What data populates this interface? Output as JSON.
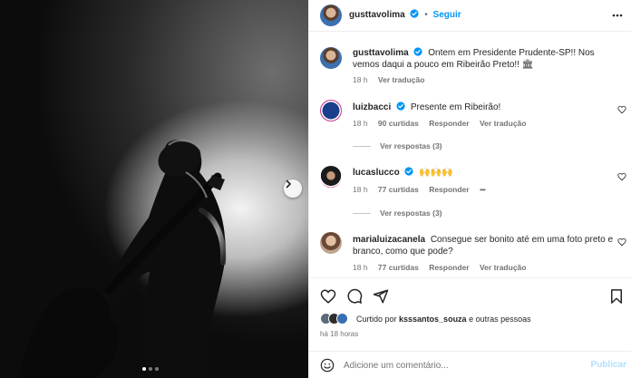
{
  "post": {
    "author": "gusttavolima",
    "follow_label": "Seguir",
    "separator": "•"
  },
  "caption": {
    "username": "gusttavolima",
    "text": "Ontem em Presidente Prudente-SP!! Nos vemos daqui a pouco em Ribeirão Preto!! 🏛",
    "time": "18 h",
    "translate": "Ver tradução"
  },
  "comments": [
    {
      "username": "luizbacci",
      "verified": true,
      "text": "Presente em Ribeirão!",
      "time": "18 h",
      "likes": "90 curtidas",
      "reply": "Responder",
      "translate": "Ver tradução",
      "view_replies": "Ver respostas (3)"
    },
    {
      "username": "lucaslucco",
      "verified": true,
      "text": "🙌🙌🙌",
      "time": "18 h",
      "likes": "77 curtidas",
      "reply": "Responder",
      "more": "•••",
      "view_replies": "Ver respostas (3)"
    },
    {
      "username": "marialuizacanela",
      "verified": false,
      "text": "Consegue ser bonito até em uma foto preto e branco, como que pode?",
      "time": "18 h",
      "likes": "77 curtidas",
      "reply": "Responder",
      "translate": "Ver tradução"
    }
  ],
  "likes": {
    "prefix": "Curtido por ",
    "user": "ksssantos_souza",
    "suffix": " e outras pessoas"
  },
  "post_time": "há 18 horas",
  "add_comment": {
    "placeholder": "Adicione um comentário...",
    "publish": "Publicar"
  },
  "carousel": {
    "slides": 3,
    "active_index": 1
  },
  "colors": {
    "accent": "#0095f6",
    "text": "#262626",
    "muted": "#737373",
    "border": "#efefef"
  },
  "icons": {
    "verified": "verified-badge-icon",
    "heart": "heart-icon",
    "comment": "comment-icon",
    "share": "share-icon",
    "save": "bookmark-icon",
    "emoji": "emoji-icon",
    "more": "more-icon",
    "next": "chevron-right-icon"
  }
}
